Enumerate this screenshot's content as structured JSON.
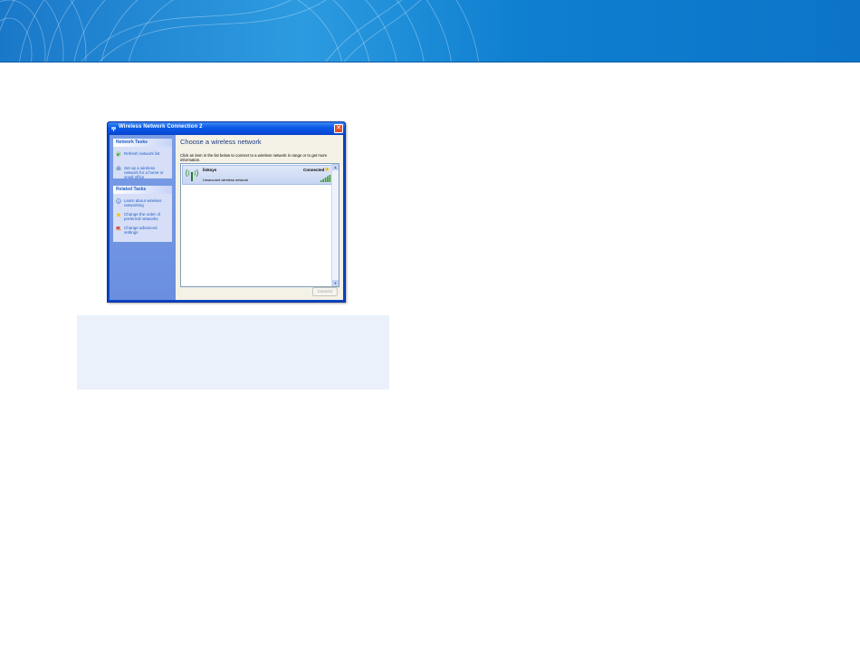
{
  "window": {
    "title": "Wireless Network Connection 2",
    "close_glyph": "✕"
  },
  "sidebar": {
    "network_tasks": {
      "header": "Network Tasks",
      "items": [
        {
          "label": "Refresh network list",
          "icon": "refresh-icon"
        },
        {
          "label": "Set up a wireless network for a home or small office",
          "icon": "setup-wireless-icon"
        }
      ]
    },
    "related_tasks": {
      "header": "Related Tasks",
      "items": [
        {
          "label": "Learn about wireless networking",
          "icon": "info-icon"
        },
        {
          "label": "Change the order of preferred networks",
          "icon": "star-icon"
        },
        {
          "label": "Change advanced settings",
          "icon": "settings-icon"
        }
      ]
    }
  },
  "main": {
    "heading": "Choose a wireless network",
    "instructions": "Click an item in the list below to connect to a wireless network in range or to get more information.",
    "networks": [
      {
        "name": "linksys",
        "status": "Connected",
        "security": "Unsecured wireless network",
        "signal_bars": 5,
        "preferred": true
      }
    ],
    "connect_label": "Connect"
  },
  "colors": {
    "banner": "#1a78c9",
    "titlebar": "#0b5ae6",
    "task_link": "#215dc6",
    "note_box": "#eaf1fb"
  },
  "glyphs": {
    "star": "★",
    "scroll_up": "▲",
    "scroll_down": "▼"
  }
}
